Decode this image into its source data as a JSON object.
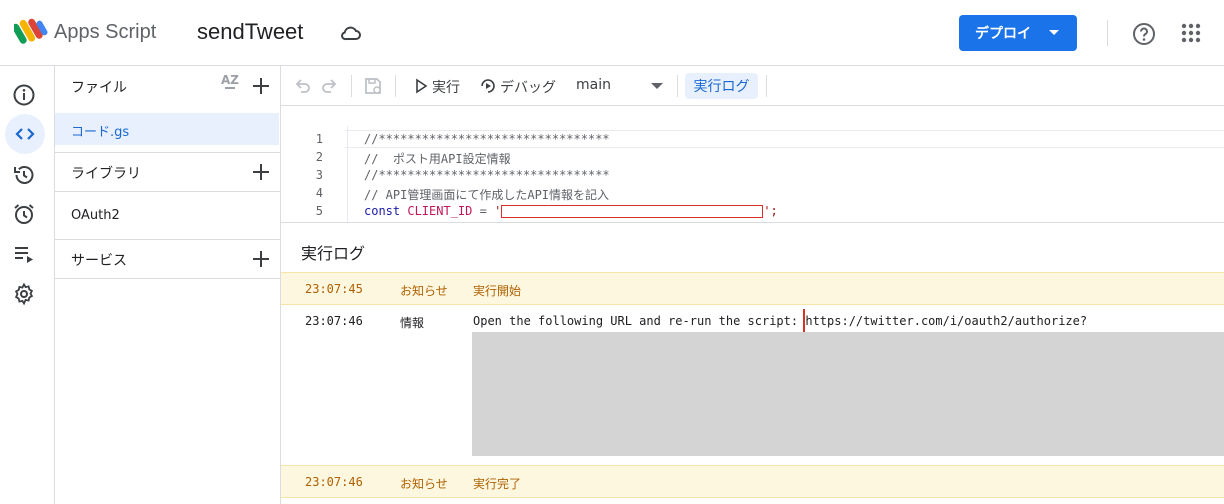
{
  "header": {
    "brand": "Apps Script",
    "project_name": "sendTweet",
    "deploy_label": "デプロイ",
    "accent_color": "#1a73e8"
  },
  "rail": {
    "items": [
      "info-icon",
      "code-icon",
      "history-icon",
      "alarm-icon",
      "executions-icon",
      "settings-icon"
    ],
    "active": "code-icon"
  },
  "files": {
    "files_title": "ファイル",
    "sort_label": "AZ",
    "files_list": [
      "コード.gs"
    ],
    "libraries_title": "ライブラリ",
    "libraries_list": [
      "OAuth2"
    ],
    "services_title": "サービス"
  },
  "toolbar": {
    "run_label": "実行",
    "debug_label": "デバッグ",
    "function_name": "main",
    "log_label": "実行ログ"
  },
  "editor": {
    "lines": [
      {
        "n": "1",
        "text": "//********************************"
      },
      {
        "n": "2",
        "text": "//  ポスト用API設定情報"
      },
      {
        "n": "3",
        "text": "//********************************"
      },
      {
        "n": "4",
        "text": "// API管理画面にて作成したAPI情報を記入"
      },
      {
        "n": "5",
        "kw": "const",
        "name": "CLIENT_ID",
        "op": "=",
        "open": "'",
        "close": "';"
      }
    ]
  },
  "log": {
    "title": "実行ログ",
    "rows": [
      {
        "time": "23:07:45",
        "level": "お知らせ",
        "msg": "実行開始"
      },
      {
        "time": "23:07:46",
        "level": "情報",
        "msg_a": "Open the following URL and re-run the script: ",
        "msg_b": "https://twitter.com/i/oauth2/authorize?"
      },
      {
        "time": "23:07:46",
        "level": "お知らせ",
        "msg": "実行完了"
      }
    ]
  }
}
